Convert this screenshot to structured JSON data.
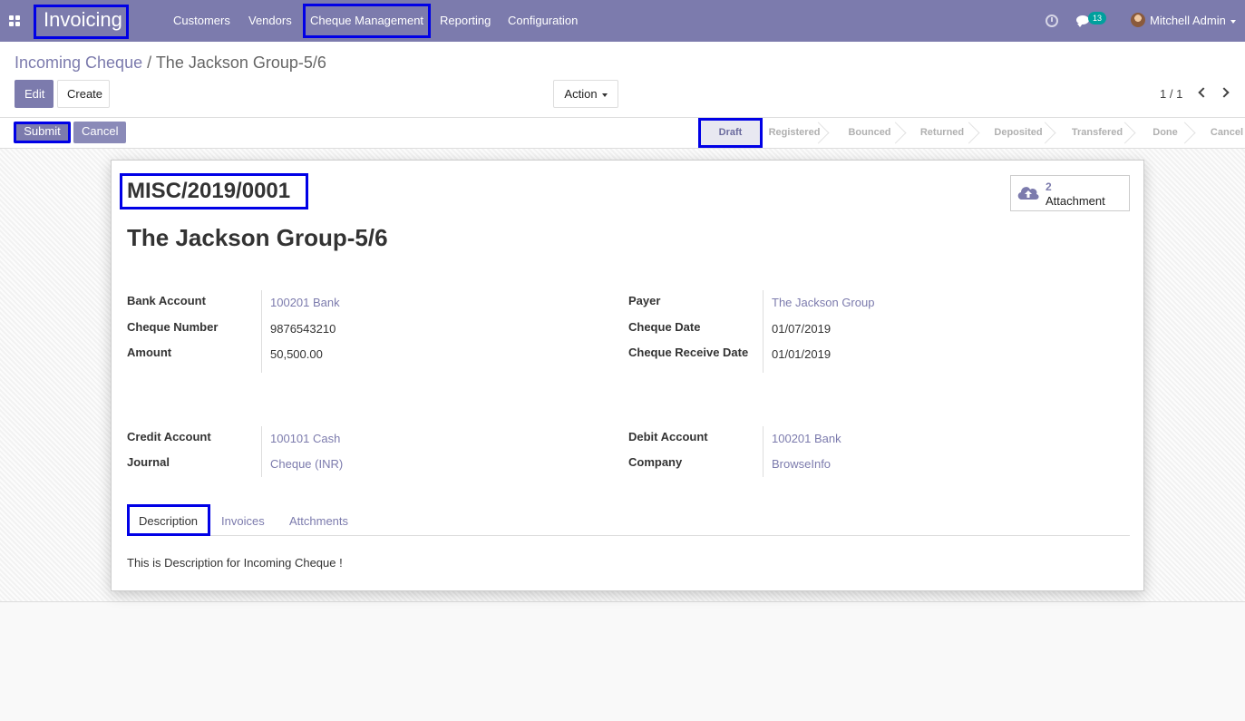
{
  "navbar": {
    "app_name": "Invoicing",
    "menu": [
      "Customers",
      "Vendors",
      "Cheque Management",
      "Reporting",
      "Configuration"
    ],
    "message_count": "13",
    "user_name": "Mitchell Admin",
    "color": "#7c7bad"
  },
  "breadcrumb": {
    "parent": "Incoming Cheque",
    "separator": "/",
    "current": "The Jackson Group-5/6"
  },
  "toolbar": {
    "edit_label": "Edit",
    "create_label": "Create",
    "action_label": "Action",
    "pager": "1 / 1"
  },
  "statusbar": {
    "submit_label": "Submit",
    "cancel_label": "Cancel",
    "stages": [
      "Draft",
      "Registered",
      "Bounced",
      "Returned",
      "Deposited",
      "Transfered",
      "Done",
      "Cancel"
    ],
    "active_stage": "Draft"
  },
  "record": {
    "number": "MISC/2019/0001",
    "title": "The Jackson Group-5/6",
    "attachment_count": "2",
    "attachment_label": "Attachment",
    "fields_left_1": [
      {
        "label": "Bank Account",
        "value": "100201 Bank"
      },
      {
        "label": "Cheque Number",
        "value": "9876543210"
      },
      {
        "label": "Amount",
        "value": "50,500.00"
      }
    ],
    "fields_right_1": [
      {
        "label": "Payer",
        "value": "The Jackson Group"
      },
      {
        "label": "Cheque Date",
        "value": "01/07/2019"
      },
      {
        "label": "Cheque Receive Date",
        "value": "01/01/2019"
      }
    ],
    "fields_left_2": [
      {
        "label": "Credit Account",
        "value": "100101 Cash"
      },
      {
        "label": "Journal",
        "value": "Cheque (INR)"
      }
    ],
    "fields_right_2": [
      {
        "label": "Debit Account",
        "value": "100201 Bank"
      },
      {
        "label": "Company",
        "value": "BrowseInfo"
      }
    ]
  },
  "tabs": {
    "items": [
      "Description",
      "Invoices",
      "Attchments"
    ],
    "description_text": "This is Description for Incoming Cheque !"
  }
}
